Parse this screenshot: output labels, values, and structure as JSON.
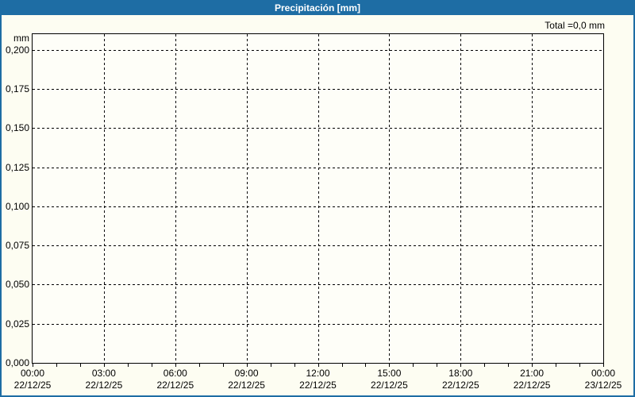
{
  "title": "Precipitación [mm]",
  "total_label": "Total =0,0 mm",
  "y_axis": {
    "unit": "mm",
    "ticks": [
      {
        "label": "0,200",
        "value": 0.2
      },
      {
        "label": "0,175",
        "value": 0.175
      },
      {
        "label": "0,150",
        "value": 0.15
      },
      {
        "label": "0,125",
        "value": 0.125
      },
      {
        "label": "0,100",
        "value": 0.1
      },
      {
        "label": "0,075",
        "value": 0.075
      },
      {
        "label": "0,050",
        "value": 0.05
      },
      {
        "label": "0,025",
        "value": 0.025
      },
      {
        "label": "0,000",
        "value": 0.0
      }
    ]
  },
  "x_axis": {
    "ticks": [
      {
        "time": "00:00",
        "date": "22/12/25",
        "hour": 0
      },
      {
        "time": "03:00",
        "date": "22/12/25",
        "hour": 3
      },
      {
        "time": "06:00",
        "date": "22/12/25",
        "hour": 6
      },
      {
        "time": "09:00",
        "date": "22/12/25",
        "hour": 9
      },
      {
        "time": "12:00",
        "date": "22/12/25",
        "hour": 12
      },
      {
        "time": "15:00",
        "date": "22/12/25",
        "hour": 15
      },
      {
        "time": "18:00",
        "date": "22/12/25",
        "hour": 18
      },
      {
        "time": "21:00",
        "date": "22/12/25",
        "hour": 21
      },
      {
        "time": "00:00",
        "date": "23/12/25",
        "hour": 24
      }
    ],
    "minor_tick_every_hours": 1,
    "total_hours": 24
  },
  "colors": {
    "titlebar_blue": "#1e6da4",
    "panel_border_blue": "#1e6da4",
    "grid_black": "#000000",
    "panel_background": "#fdfdf2",
    "title_text": "#ffffff"
  },
  "chart_data": {
    "type": "line",
    "title": "Precipitación [mm]",
    "xlabel": "",
    "ylabel": "mm",
    "ylim": [
      0,
      0.21
    ],
    "y_tick_values": [
      0.0,
      0.025,
      0.05,
      0.075,
      0.1,
      0.125,
      0.15,
      0.175,
      0.2
    ],
    "y_tick_labels": [
      "0,000",
      "0,025",
      "0,050",
      "0,075",
      "0,100",
      "0,125",
      "0,150",
      "0,175",
      "0,200"
    ],
    "x_range_hours": [
      0,
      24
    ],
    "x_tick_labels": [
      "00:00 22/12/25",
      "03:00 22/12/25",
      "06:00 22/12/25",
      "09:00 22/12/25",
      "12:00 22/12/25",
      "15:00 22/12/25",
      "18:00 22/12/25",
      "21:00 22/12/25",
      "00:00 23/12/25"
    ],
    "grid": true,
    "grid_style": "dashed",
    "legend": null,
    "series": [],
    "total_mm": 0.0,
    "annotations": [
      "Total =0,0 mm"
    ]
  }
}
